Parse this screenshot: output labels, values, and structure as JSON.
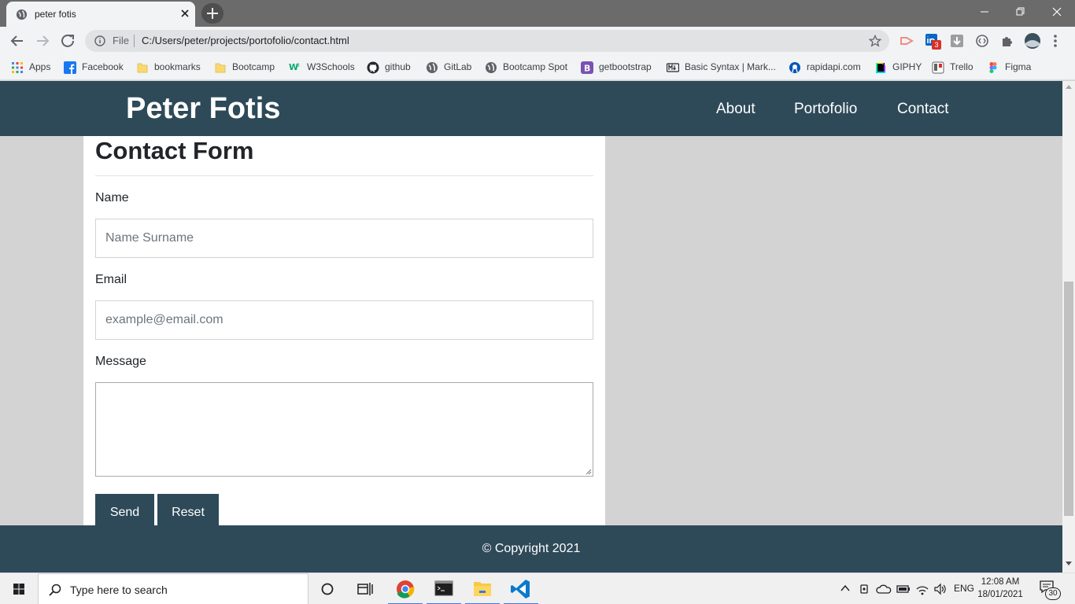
{
  "browser": {
    "tab_title": "peter fotis",
    "omnibox": {
      "scheme_label": "File",
      "url": "C:/Users/peter/projects/portofolio/contact.html"
    },
    "extension_badge": "3",
    "bookmarks": [
      {
        "label": "Apps",
        "icon": "apps-grid-icon"
      },
      {
        "label": "Facebook",
        "icon": "facebook-icon"
      },
      {
        "label": "bookmarks",
        "icon": "folder-icon"
      },
      {
        "label": "Bootcamp",
        "icon": "folder-icon"
      },
      {
        "label": "W3Schools",
        "icon": "w3schools-icon"
      },
      {
        "label": "github",
        "icon": "github-icon"
      },
      {
        "label": "GitLab",
        "icon": "globe-icon"
      },
      {
        "label": "Bootcamp Spot",
        "icon": "globe-icon"
      },
      {
        "label": "getbootstrap",
        "icon": "bootstrap-icon"
      },
      {
        "label": "Basic Syntax | Mark...",
        "icon": "markdown-icon"
      },
      {
        "label": "rapidapi.com",
        "icon": "rapidapi-icon"
      },
      {
        "label": "GIPHY",
        "icon": "giphy-icon"
      },
      {
        "label": "Trello",
        "icon": "trello-icon"
      },
      {
        "label": "Figma",
        "icon": "figma-icon"
      }
    ]
  },
  "site": {
    "brand": "Peter Fotis",
    "nav": [
      "About",
      "Portofolio",
      "Contact"
    ],
    "form": {
      "title": "Contact Form",
      "name_label": "Name",
      "name_placeholder": "Name Surname",
      "email_label": "Email",
      "email_placeholder": "example@email.com",
      "message_label": "Message",
      "send_label": "Send",
      "reset_label": "Reset"
    },
    "footer": "© Copyright 2021"
  },
  "taskbar": {
    "search_placeholder": "Type here to search",
    "language": "ENG",
    "time": "12:08 AM",
    "date": "18/01/2021",
    "notification_count": "30"
  },
  "colors": {
    "header_bg": "#2e4a59",
    "page_bg": "#d3d3d3",
    "button_bg": "#2e4a59"
  }
}
